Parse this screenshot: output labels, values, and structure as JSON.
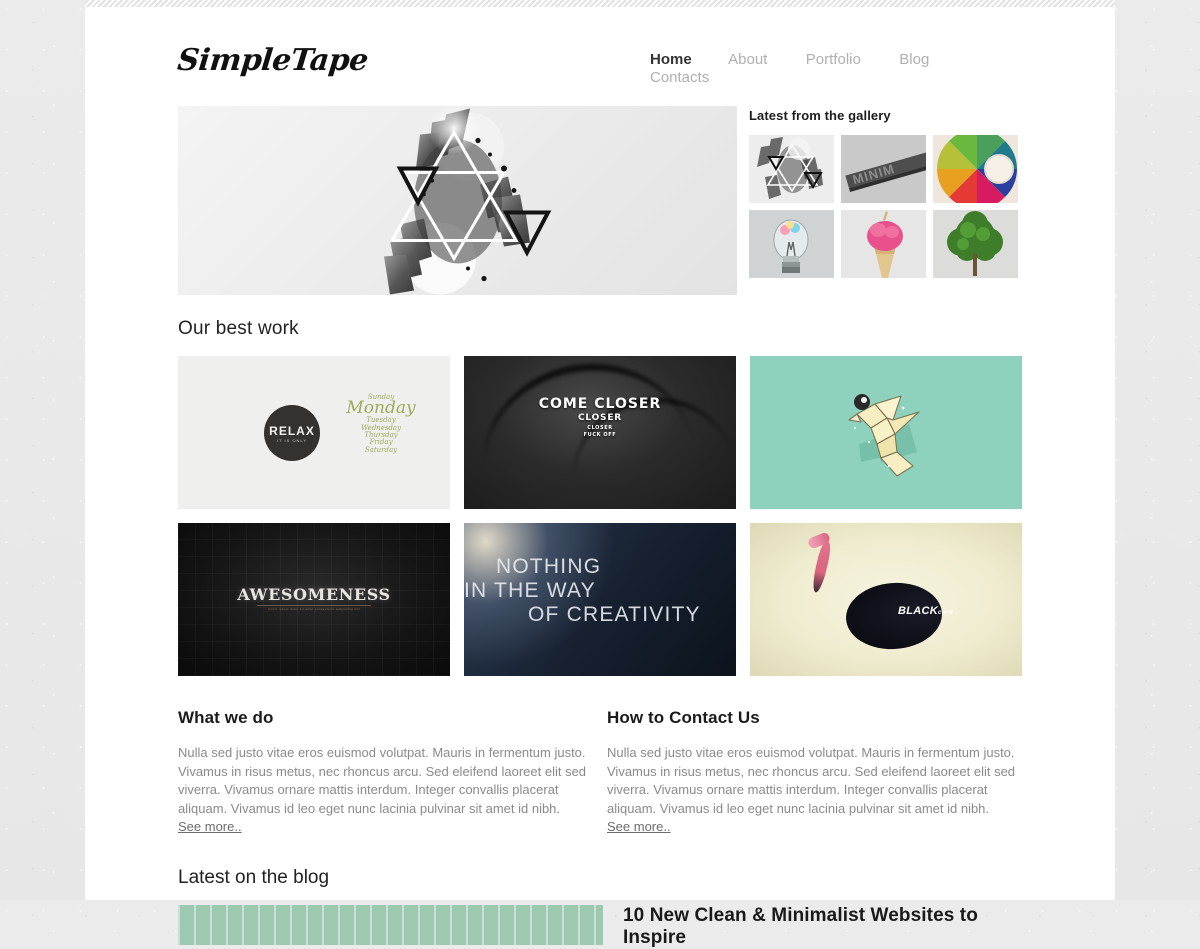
{
  "site": {
    "logo_text": "SimpleTape"
  },
  "nav": {
    "items": [
      {
        "label": "Home",
        "active": true
      },
      {
        "label": "About",
        "active": false
      },
      {
        "label": "Portfolio",
        "active": false
      },
      {
        "label": "Blog",
        "active": false
      },
      {
        "label": "Contacts",
        "active": false
      }
    ]
  },
  "hero": {
    "alt": "abstract geometric triangles over bird wings artwork"
  },
  "gallery": {
    "title": "Latest from the gallery",
    "thumbs": [
      {
        "name": "geometric-bird-artwork"
      },
      {
        "name": "minim-text-photo",
        "caption": "MINIM"
      },
      {
        "name": "color-wheel-photo"
      },
      {
        "name": "lightbulb-photo"
      },
      {
        "name": "ice-cream-cone-photo"
      },
      {
        "name": "tree-photo"
      }
    ]
  },
  "work": {
    "title": "Our best work",
    "items": [
      {
        "name": "relax-monday-poster",
        "badge_text": "RELAX",
        "badge_sub": "IT IS ONLY",
        "days": [
          "Sunday",
          "Monday",
          "Tuesday",
          "Wednesday",
          "Thursday",
          "Friday",
          "Saturday"
        ]
      },
      {
        "name": "come-closer-poster",
        "lines": [
          "COME CLOSER",
          "CLOSER",
          "CLOSER",
          "FUCK OFF"
        ]
      },
      {
        "name": "origami-bird-illustration"
      },
      {
        "name": "awesomeness-poster",
        "headline": "AWESOMENESS",
        "subline": "lorem ipsum dolor sit amet consectetur adipiscing elit"
      },
      {
        "name": "nothing-in-the-way-of-creativity-poster",
        "lines": [
          "NOTHING",
          "IN THE WAY",
          "OF CREATIVITY"
        ]
      },
      {
        "name": "blackcord-flamingo-poster",
        "brand": "BLACK",
        "brand_sub": "cord"
      }
    ]
  },
  "columns": [
    {
      "title": "What we do",
      "body": "Nulla sed justo vitae eros euismod volutpat. Mauris in fermentum justo. Vivamus in risus metus, nec rhoncus arcu. Sed eleifend laoreet elit sed viverra. Vivamus ornare mattis interdum. Integer convallis placerat aliquam. Vivamus id leo eget nunc lacinia pulvinar sit amet id nibh. ",
      "link": "See more.."
    },
    {
      "title": "How to Contact Us",
      "body": "Nulla sed justo vitae eros euismod volutpat. Mauris in fermentum justo. Vivamus in risus metus, nec rhoncus arcu. Sed eleifend laoreet elit sed viverra. Vivamus ornare mattis interdum. Integer convallis placerat aliquam. Vivamus id leo eget nunc lacinia pulvinar sit amet id nibh. ",
      "link": "See more.."
    }
  ],
  "blog": {
    "title": "Latest on the blog",
    "post_headline": "10 New Clean & Minimalist Websites to Inspire"
  },
  "colors": {
    "page_bg": "#ffffff",
    "body_bg": "#e9e9e9",
    "nav_active": "#333333",
    "nav_idle": "#b0b0b0",
    "mint": "#8ed2bd",
    "blog_thumb": "#9dc9b0",
    "relax_green": "#9dab5b"
  }
}
